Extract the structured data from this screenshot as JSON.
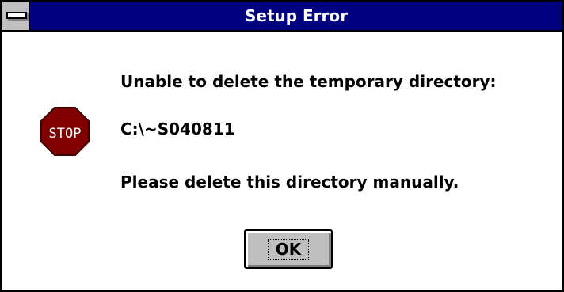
{
  "window": {
    "title": "Setup Error"
  },
  "icon": {
    "name": "stop-icon",
    "label": "STOP",
    "color": "#800000"
  },
  "message": {
    "line1": "Unable to delete the temporary directory:",
    "line2": "C:\\~S040811",
    "line3": "Please delete this directory manually."
  },
  "buttons": {
    "ok_label": "OK"
  },
  "colors": {
    "titlebar": "#000080",
    "button_face": "#c0c0c0"
  }
}
